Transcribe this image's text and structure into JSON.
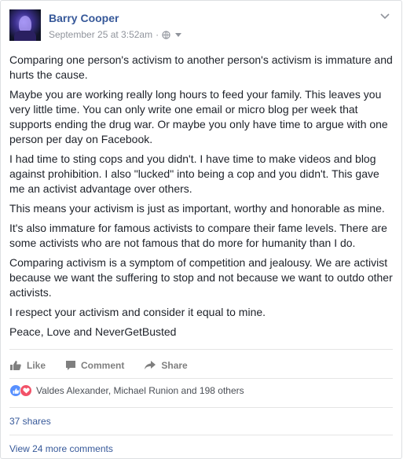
{
  "post": {
    "author": "Barry Cooper",
    "timestamp": "September 25 at 3:52am",
    "separator": "·",
    "privacy_icon": "globe-icon",
    "paragraphs": [
      "Comparing one person's activism to another person's activism is immature and hurts the cause.",
      "Maybe you are working really long hours to feed your family. This leaves you very little time. You can only write one email or micro blog per week that supports ending the drug war. Or maybe you only have time to argue with one person per day on Facebook.",
      "I had time to sting cops and you didn't. I have time to make videos and blog against prohibition. I also \"lucked\" into being a cop and you didn't. This gave me an activist advantage over others.",
      "This means your activism is just as important, worthy and honorable as mine.",
      "It's also immature for famous activists to compare their fame levels. There are some activists who are not famous that do more for humanity than I do.",
      "Comparing activism is a symptom of competition and jealousy. We are activist because we want the suffering to stop and not because we want to outdo other activists.",
      "I respect your activism and consider it equal to mine.",
      "Peace, Love and NeverGetBusted"
    ]
  },
  "actions": {
    "like": "Like",
    "comment": "Comment",
    "share": "Share"
  },
  "reactions": {
    "names": "Valdes Alexander, Michael Runion and 198 others"
  },
  "shares": "37 shares",
  "comments": {
    "more": "View 24 more comments"
  },
  "colors": {
    "link": "#365899",
    "meta": "#90949c",
    "like_blue": "#5890ff",
    "love_red": "#f25268"
  }
}
